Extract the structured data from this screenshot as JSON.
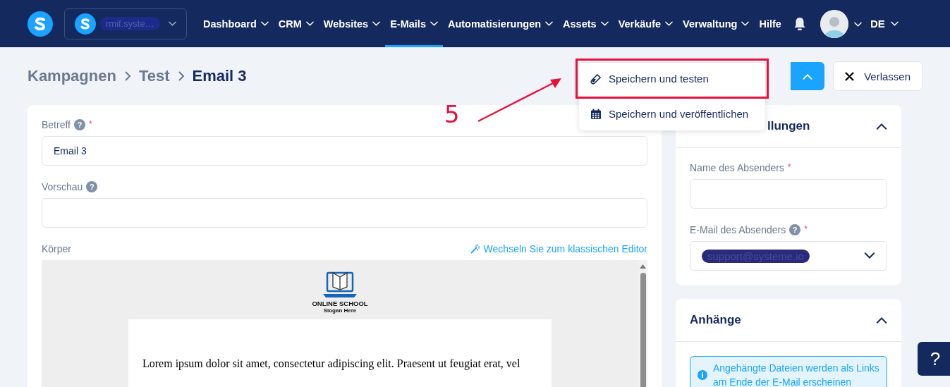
{
  "nav": {
    "account": "rmif.syste…",
    "items": [
      {
        "label": "Dashboard",
        "selected": false,
        "has_menu": true
      },
      {
        "label": "CRM",
        "selected": false,
        "has_menu": true
      },
      {
        "label": "Websites",
        "selected": false,
        "has_menu": true
      },
      {
        "label": "E-Mails",
        "selected": true,
        "has_menu": true
      },
      {
        "label": "Automatisierungen",
        "selected": false,
        "has_menu": true
      },
      {
        "label": "Assets",
        "selected": false,
        "has_menu": true
      },
      {
        "label": "Verkäufe",
        "selected": false,
        "has_menu": true
      },
      {
        "label": "Verwaltung",
        "selected": false,
        "has_menu": true
      },
      {
        "label": "Hilfe",
        "selected": false,
        "has_menu": false
      }
    ],
    "language": "DE"
  },
  "breadcrumb": [
    "Kampagnen",
    "Test",
    "Email 3"
  ],
  "actions": {
    "menu": [
      {
        "label": "Speichern und testen",
        "kind": "test",
        "highlighted": true
      },
      {
        "label": "Speichern und veröffentlichen",
        "kind": "schedule",
        "highlighted": false
      }
    ],
    "exit": "Verlassen"
  },
  "form": {
    "subject": {
      "label": "Betreff",
      "hint": "?",
      "required_mark": "*",
      "value": "Email 3"
    },
    "preview": {
      "label": "Vorschau",
      "hint": "?"
    },
    "body": {
      "label": "Körper",
      "switch_link": "Wechseln Sie zum klassischen Editor",
      "logo_title": "ONLINE SCHOOL",
      "logo_slogan": "Slogan Here",
      "text": "Lorem ipsum dolor sit amet, consectetur adipiscing elit. Praesent ut feugiat erat, vel"
    }
  },
  "settings": {
    "title": "llungen",
    "sender_name": {
      "label": "Name des Absenders",
      "required_mark": "*"
    },
    "sender_email": {
      "label": "E-Mail des Absenders",
      "hint": "?",
      "required_mark": "*",
      "value": "support@systeme.io"
    }
  },
  "attachments": {
    "title": "Anhänge",
    "info": "Angehängte Dateien werden als Links am Ende der E-Mail erscheinen"
  },
  "annotation": {
    "step": "5"
  },
  "help_button": "?"
}
